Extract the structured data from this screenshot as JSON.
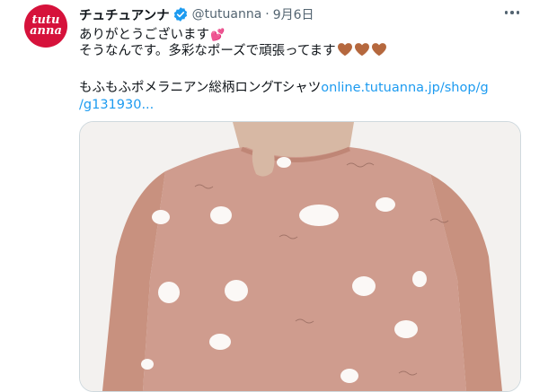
{
  "tweet": {
    "display_name": "チュチュアンナ",
    "handle": "@tutuanna",
    "separator": "·",
    "date": "9月6日",
    "avatar": {
      "line1": "tutu",
      "line2": "anna"
    },
    "lines": {
      "line1": "ありがとうございます",
      "line2": "そうなんです。多彩なポーズで頑張ってます",
      "line3_text": "もふもふポメラニアン総柄ロングTシャツ",
      "line3_link": "online.tutuanna.jp/shop/g",
      "line4_link": "/g131930..."
    }
  },
  "icons": {
    "verified": "verified-badge-icon",
    "more": "more-options-icon",
    "heart": "sparkling-heart-icon",
    "brown_heart": "brown-heart-icon"
  },
  "colors": {
    "brand": "#d6123b",
    "link": "#1d9bf0",
    "shirt": "#cf9c8e",
    "brown_heart": "#b5683e"
  }
}
